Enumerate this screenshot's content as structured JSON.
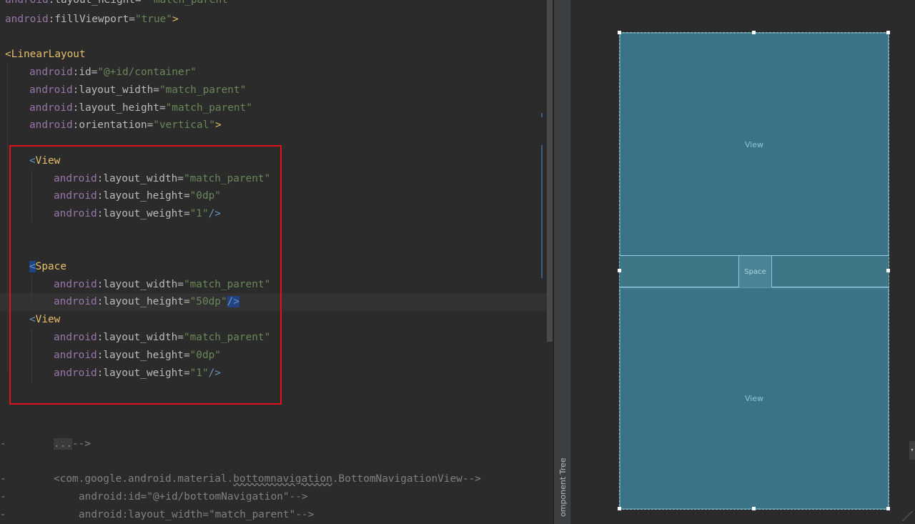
{
  "editor": {
    "lines": {
      "l0": {
        "ns": "android",
        "attr": ":layout_height=",
        "val": "\"match_parent\""
      },
      "l1": {
        "ns": "android",
        "attr": ":fillViewport=",
        "val": "\"true\"",
        "end": ">"
      },
      "l3": {
        "open": "<",
        "tag": "LinearLayout"
      },
      "l4": {
        "ns": "android",
        "attr": ":id=",
        "val": "\"@+id/container\""
      },
      "l5": {
        "ns": "android",
        "attr": ":layout_width=",
        "val": "\"match_parent\""
      },
      "l6": {
        "ns": "android",
        "attr": ":layout_height=",
        "val": "\"match_parent\""
      },
      "l7": {
        "ns": "android",
        "attr": ":orientation=",
        "val": "\"vertical\"",
        "end": ">"
      },
      "l9": {
        "open": "<",
        "tag": "View"
      },
      "l10": {
        "ns": "android",
        "attr": ":layout_width=",
        "val": "\"match_parent\""
      },
      "l11": {
        "ns": "android",
        "attr": ":layout_height=",
        "val": "\"0dp\""
      },
      "l12": {
        "ns": "android",
        "attr": ":layout_weight=",
        "val": "\"1\"",
        "end": "/>"
      },
      "l15": {
        "open": "<",
        "tag": "Space"
      },
      "l16": {
        "ns": "android",
        "attr": ":layout_width=",
        "val": "\"match_parent\""
      },
      "l17": {
        "ns": "android",
        "attr": ":layout_height=",
        "val": "\"50dp\"",
        "end": "/>"
      },
      "l18": {
        "open": "<",
        "tag": "View"
      },
      "l19": {
        "ns": "android",
        "attr": ":layout_width=",
        "val": "\"match_parent\""
      },
      "l20": {
        "ns": "android",
        "attr": ":layout_height=",
        "val": "\"0dp\""
      },
      "l21": {
        "ns": "android",
        "attr": ":layout_weight=",
        "val": "\"1\"",
        "end": "/>"
      },
      "l24": {
        "dots": "...",
        "tail": "-->"
      },
      "l26": {
        "pre": "<com.google.android.material.",
        "squiggle": "bottomnavigation",
        "post": ".BottomNavigationView-->"
      },
      "l27": {
        "text": "android:id=\"@+id/bottomNavigation\"-->"
      },
      "l28": {
        "text": "android:layout_width=\"match_parent\"-->"
      }
    },
    "fold_dash": "-"
  },
  "side_panel": {
    "tab_label": "omponent Tree"
  },
  "design": {
    "view_top_label": "View",
    "space_label": "Space",
    "view_bottom_label": "View",
    "edge_button": "▾"
  },
  "colors": {
    "highlight_box": "#e0121a",
    "view_fill": "#3b7386",
    "editor_bg": "#2b2b2b"
  }
}
